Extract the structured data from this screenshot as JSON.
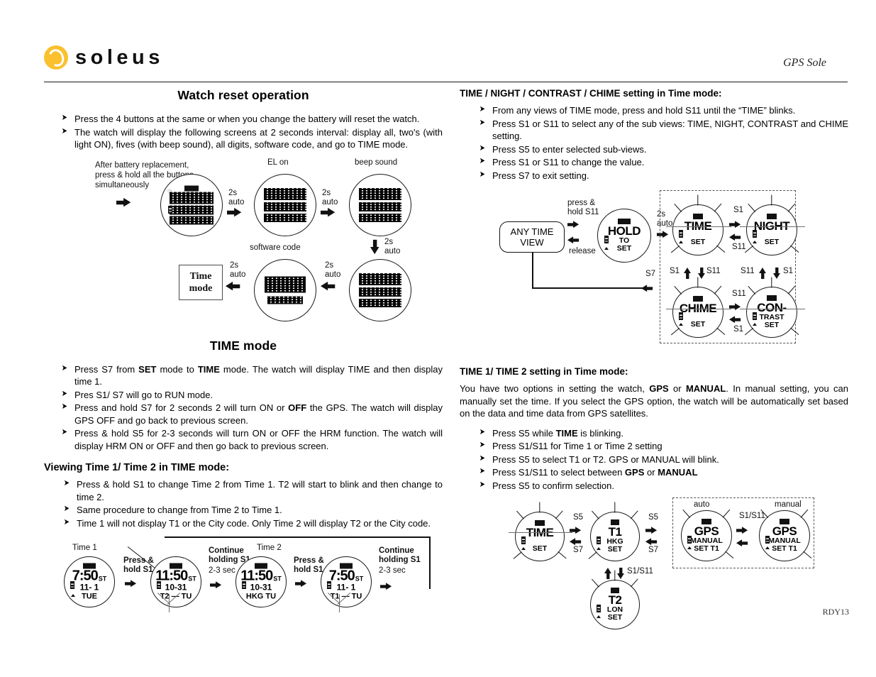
{
  "header": {
    "brand": "soleus",
    "brand_icon": "soleus-swirl-logo",
    "brand_color": "#fbc02d",
    "doc_title": "GPS Sole"
  },
  "footer": {
    "code": "RDY13"
  },
  "left_column": {
    "title": "Watch reset operation",
    "bullets": [
      "Press the 4 buttons at the same or when you change the battery will reset the watch.",
      "The watch will display the following screens at 2 seconds interval: display all, two's (with light ON), fives (with beep sound), all digits, software code, and go to TIME mode."
    ],
    "reset_diagram": {
      "intro_lines": [
        "After battery replacement,",
        "press & hold all the buttons",
        "simultaneously"
      ],
      "labels": {
        "el_on": "EL on",
        "beep": "beep sound",
        "software": "software code",
        "auto2s": "2s\nauto",
        "auto_line1": "2s",
        "auto_line2": "auto"
      },
      "time_mode_box": [
        "Time",
        "mode"
      ],
      "screens": [
        {
          "name": "display-all",
          "caption": ""
        },
        {
          "name": "twos-with-light-on",
          "caption": "EL on",
          "digits": "2222"
        },
        {
          "name": "fives-with-beep",
          "caption": "beep sound",
          "digits": "5555"
        },
        {
          "name": "all-digits",
          "caption": "",
          "digits": "8888"
        },
        {
          "name": "software-code",
          "caption": "software code",
          "digits": "1333",
          "sub": "01-001"
        }
      ]
    },
    "time_mode": {
      "title": "TIME mode",
      "bullets": [
        {
          "parts": [
            {
              "t": "Press S7 from "
            },
            {
              "t": "SET",
              "b": true
            },
            {
              "t": " mode to "
            },
            {
              "t": "TIME",
              "b": true
            },
            {
              "t": " mode. The watch will display TIME and then display time 1."
            }
          ]
        },
        {
          "parts": [
            {
              "t": "Pres S1/ S7 will go to RUN mode."
            }
          ]
        },
        {
          "parts": [
            {
              "t": "Press and hold S7 for 2 seconds 2 will turn ON or "
            },
            {
              "t": "OFF",
              "b": true
            },
            {
              "t": " the GPS. The watch will display GPS OFF and go back to previous screen."
            }
          ]
        },
        {
          "parts": [
            {
              "t": "Press & hold S5 for 2-3 seconds will turn ON or OFF the HRM function. The watch will display HRM ON or OFF and then go back to previous screen."
            }
          ]
        }
      ]
    },
    "viewing": {
      "title": "Viewing Time 1/ Time 2 in TIME mode:",
      "bullets": [
        "Press & hold S1 to change Time 2 from Time 1. T2 will start to blink and then change to time 2.",
        "Same procedure to change from Time 2 to Time 1.",
        "Time 1 will not display T1 or the City code. Only Time 2 will display T2 or the City code."
      ],
      "diagram": {
        "labels": {
          "time1": "Time 1",
          "time2": "Time 2",
          "press_hold_1": "Press &\nhold S1",
          "press_hold_2": "Press &\nhold S1",
          "continue_1": "Continue\nholding S1",
          "continue_1_sec": "2-3 sec",
          "continue_2": "Continue\nholding S1",
          "continue_2_sec": "2-3 sec"
        },
        "watches": [
          {
            "name": "time1-view",
            "big": "7:50",
            "unit": "ST",
            "mid": "11- 1",
            "bot": "TUE"
          },
          {
            "name": "t2-blink",
            "big": "11:50",
            "unit": "ST",
            "mid": "10-31",
            "bot": "T2 — TU",
            "blink": true
          },
          {
            "name": "time2-view",
            "big": "11:50",
            "unit": "ST",
            "mid": "10-31",
            "bot": "HKG TU"
          },
          {
            "name": "t1-blink",
            "big": "7:50",
            "unit": "ST",
            "mid": "11- 1",
            "bot": "T1 — TU",
            "blink": true
          }
        ]
      }
    }
  },
  "right_column": {
    "setting_section": {
      "title": "TIME / NIGHT / CONTRAST / CHIME setting in Time mode:",
      "bullets": [
        "From any views of TIME mode, press and hold S11 until the “TIME” blinks.",
        "Press S1 or S11 to select any of the sub views: TIME, NIGHT, CONTRAST and CHIME setting.",
        "Press S5 to enter selected sub-views.",
        "Press S1 or S11 to change the value.",
        "Press S7 to exit setting."
      ],
      "diagram": {
        "any_time_view": [
          "ANY TIME",
          "VIEW"
        ],
        "labels": {
          "press_hold_s11": "press &\nhold S11",
          "release": "release",
          "auto": "2s\nauto",
          "s1": "S1",
          "s11": "S11",
          "s7": "S7"
        },
        "watches": [
          {
            "name": "hold-to-set",
            "word": "HOLD",
            "mid": "TO",
            "bot": "SET"
          },
          {
            "name": "time-setting",
            "word": "TIME",
            "bot": "SET",
            "blink": true
          },
          {
            "name": "night-setting",
            "word": "NIGHT",
            "bot": "SET",
            "blink": true
          },
          {
            "name": "chime-setting",
            "word": "CHIME",
            "bot": "SET",
            "blink": true
          },
          {
            "name": "contrast-setting",
            "word": "CON-",
            "mid": "TRAST",
            "bot": "SET",
            "blink": true
          }
        ]
      }
    },
    "time12_section": {
      "title": "TIME 1/ TIME 2 setting in Time mode:",
      "paragraph_parts": [
        {
          "t": "You have two options in setting the watch, "
        },
        {
          "t": "GPS",
          "b": true
        },
        {
          "t": " or "
        },
        {
          "t": "MANUAL",
          "b": true
        },
        {
          "t": ". In manual setting, you can manually set the time. If you select the GPS option, the watch will be automatically set based on the data and time data from GPS satellites."
        }
      ],
      "bullets": [
        {
          "parts": [
            {
              "t": "Press S5 while "
            },
            {
              "t": "TIME",
              "b": true
            },
            {
              "t": " is blinking."
            }
          ]
        },
        {
          "parts": [
            {
              "t": "Press S1/S11 for Time 1 or Time 2 setting"
            }
          ]
        },
        {
          "parts": [
            {
              "t": "Press S5 to select T1 or T2. GPS or MANUAL will blink."
            }
          ]
        },
        {
          "parts": [
            {
              "t": "Press S1/S11  to select between "
            },
            {
              "t": "GPS",
              "b": true
            },
            {
              "t": " or "
            },
            {
              "t": "MANUAL",
              "b": true
            }
          ]
        },
        {
          "parts": [
            {
              "t": "Press S5 to confirm selection."
            }
          ]
        }
      ],
      "diagram": {
        "labels": {
          "s5a": "S5",
          "s7a": "S7",
          "s5b": "S5",
          "s7b": "S7",
          "s1s11a": "S1/S11",
          "s1s11b": "S1/S11",
          "auto": "auto",
          "manual": "manual"
        },
        "watches": [
          {
            "name": "time-blinking",
            "word": "TIME",
            "bot": "SET",
            "blink": true
          },
          {
            "name": "t1-hkg-set",
            "word": "T1",
            "mid": "HKG",
            "bot": "SET",
            "blink": true
          },
          {
            "name": "t2-lon-set",
            "word": "T2",
            "mid": "LON",
            "bot": "SET",
            "blink": true
          },
          {
            "name": "gps-manual-auto",
            "word": "GPS",
            "mid": "MANUAL",
            "bot": "SET T1",
            "blink": true
          },
          {
            "name": "gps-manual-manual",
            "word": "GPS",
            "mid": "MANUAL",
            "bot": "SET T1",
            "blink": true
          }
        ]
      }
    }
  }
}
